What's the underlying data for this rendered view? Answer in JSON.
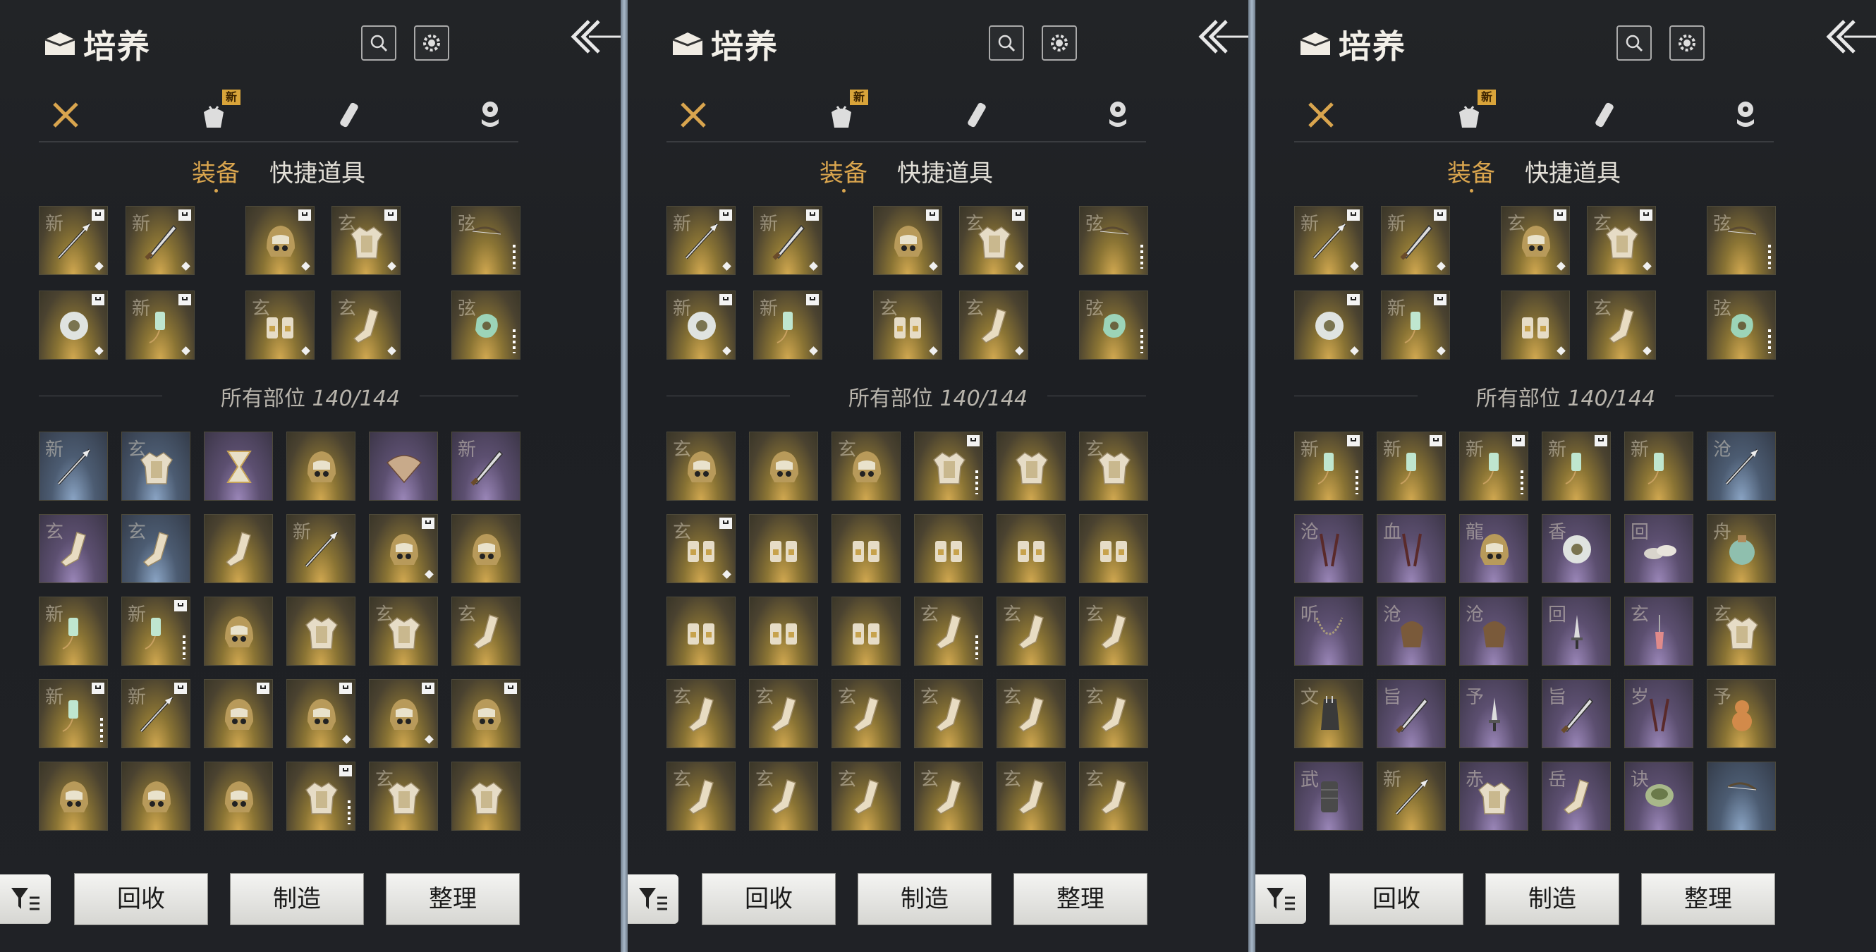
{
  "header": {
    "title": "培养",
    "search_icon": "search-icon",
    "settings_icon": "gear-icon",
    "back_icon": "back-arrows-icon"
  },
  "categories": [
    {
      "icon": "crossed-swords-icon",
      "active": true,
      "new": false
    },
    {
      "icon": "bundle-icon",
      "active": false,
      "new": true,
      "badge": "新"
    },
    {
      "icon": "scroll-icon",
      "active": false,
      "new": false
    },
    {
      "icon": "coin-stack-icon",
      "active": false,
      "new": false
    }
  ],
  "tabs": {
    "equipment": "装备",
    "quick_items": "快捷道具"
  },
  "section_label": "所有部位",
  "section_count": "140/144",
  "buttons": {
    "recycle": "回收",
    "craft": "制造",
    "sort": "整理",
    "filter_icon": "filter-icon"
  },
  "colors": {
    "gold": "#d9a54e",
    "panel_bg": "#1f2125",
    "divider": "#a8b8c8"
  },
  "panels": [
    {
      "equipped": [
        {
          "ch": "新",
          "type": "spear",
          "r": "gold",
          "flag": true,
          "mark": "dia"
        },
        {
          "ch": "新",
          "type": "blade",
          "r": "gold",
          "flag": true,
          "mark": "dia"
        },
        {
          "ch": "",
          "type": "helmet",
          "r": "gold",
          "flag": true,
          "mark": "dia"
        },
        {
          "ch": "玄",
          "type": "armor",
          "r": "gold",
          "flag": true,
          "mark": "dia"
        },
        {
          "ch": "弦",
          "type": "bow",
          "r": "gold",
          "flag": false,
          "mark": "pips"
        },
        {
          "ch": "",
          "type": "ring",
          "r": "gold",
          "flag": true,
          "mark": "dia"
        },
        {
          "ch": "新",
          "type": "pendant",
          "r": "gold",
          "flag": true,
          "mark": "dia"
        },
        {
          "ch": "玄",
          "type": "gloves",
          "r": "gold",
          "flag": false,
          "mark": "dia"
        },
        {
          "ch": "玄",
          "type": "boots",
          "r": "gold",
          "flag": false,
          "mark": "dia"
        },
        {
          "ch": "弦",
          "type": "jade",
          "r": "gold",
          "flag": false,
          "mark": "pips"
        }
      ],
      "inventory": [
        {
          "ch": "新",
          "type": "spear",
          "r": "blue",
          "flag": false,
          "mark": "dot"
        },
        {
          "ch": "玄",
          "type": "armor",
          "r": "blue",
          "flag": false,
          "mark": "gem"
        },
        {
          "ch": "",
          "type": "hourglass",
          "r": "purple",
          "flag": false,
          "mark": "dot"
        },
        {
          "ch": "",
          "type": "helmet",
          "r": "gold",
          "flag": false,
          "mark": "dot"
        },
        {
          "ch": "",
          "type": "fan",
          "r": "purple",
          "flag": false,
          "mark": "dot"
        },
        {
          "ch": "新",
          "type": "blade",
          "r": "purple",
          "flag": false,
          "mark": "dot"
        },
        {
          "ch": "玄",
          "type": "boots",
          "r": "purple",
          "flag": false,
          "mark": "dot"
        },
        {
          "ch": "玄",
          "type": "boots",
          "r": "blue",
          "flag": false,
          "mark": "dot"
        },
        {
          "ch": "",
          "type": "boots",
          "r": "gold",
          "flag": false,
          "mark": "dot"
        },
        {
          "ch": "新",
          "type": "spear",
          "r": "gold",
          "flag": false,
          "mark": "dot"
        },
        {
          "ch": "",
          "type": "helmet",
          "r": "gold",
          "flag": true,
          "mark": "dia"
        },
        {
          "ch": "",
          "type": "helmet",
          "r": "gold",
          "flag": false,
          "mark": "dot"
        },
        {
          "ch": "新",
          "type": "pendant",
          "r": "gold",
          "flag": false,
          "mark": "dot"
        },
        {
          "ch": "新",
          "type": "pendant",
          "r": "gold",
          "flag": true,
          "mark": "pips"
        },
        {
          "ch": "",
          "type": "helmet",
          "r": "gold",
          "flag": false,
          "mark": "dot"
        },
        {
          "ch": "",
          "type": "armor",
          "r": "gold",
          "flag": false,
          "mark": "dot"
        },
        {
          "ch": "玄",
          "type": "armor",
          "r": "gold",
          "flag": false,
          "mark": "dot"
        },
        {
          "ch": "玄",
          "type": "boots",
          "r": "gold",
          "flag": false,
          "mark": "dot"
        },
        {
          "ch": "新",
          "type": "pendant",
          "r": "gold",
          "flag": true,
          "mark": "pips"
        },
        {
          "ch": "新",
          "type": "spear",
          "r": "gold",
          "flag": true,
          "mark": "dot"
        },
        {
          "ch": "",
          "type": "helmet",
          "r": "gold",
          "flag": true,
          "mark": "dot"
        },
        {
          "ch": "",
          "type": "helmet",
          "r": "gold",
          "flag": true,
          "mark": "dia"
        },
        {
          "ch": "",
          "type": "helmet",
          "r": "gold",
          "flag": true,
          "mark": "dia"
        },
        {
          "ch": "",
          "type": "helmet",
          "r": "gold",
          "flag": true,
          "mark": "dot"
        },
        {
          "ch": "",
          "type": "helmet",
          "r": "gold",
          "flag": false,
          "mark": "dot"
        },
        {
          "ch": "",
          "type": "helmet",
          "r": "gold",
          "flag": false,
          "mark": "dot"
        },
        {
          "ch": "",
          "type": "helmet",
          "r": "gold",
          "flag": false,
          "mark": "dot"
        },
        {
          "ch": "",
          "type": "armor",
          "r": "gold",
          "flag": true,
          "mark": "pips"
        },
        {
          "ch": "玄",
          "type": "armor",
          "r": "gold",
          "flag": false,
          "mark": "dot"
        },
        {
          "ch": "",
          "type": "armor",
          "r": "gold",
          "flag": false,
          "mark": "dot"
        }
      ]
    },
    {
      "equipped": [
        {
          "ch": "新",
          "type": "spear",
          "r": "gold",
          "flag": true,
          "mark": "dia"
        },
        {
          "ch": "新",
          "type": "blade",
          "r": "gold",
          "flag": true,
          "mark": "dia"
        },
        {
          "ch": "",
          "type": "helmet",
          "r": "gold",
          "flag": true,
          "mark": "dia"
        },
        {
          "ch": "玄",
          "type": "armor",
          "r": "gold",
          "flag": true,
          "mark": "dia"
        },
        {
          "ch": "弦",
          "type": "bow",
          "r": "gold",
          "flag": false,
          "mark": "pips"
        },
        {
          "ch": "新",
          "type": "ring",
          "r": "gold",
          "flag": true,
          "mark": "dia"
        },
        {
          "ch": "新",
          "type": "pendant",
          "r": "gold",
          "flag": true,
          "mark": "dia"
        },
        {
          "ch": "玄",
          "type": "gloves",
          "r": "gold",
          "flag": false,
          "mark": "dia"
        },
        {
          "ch": "玄",
          "type": "boots",
          "r": "gold",
          "flag": false,
          "mark": "dia"
        },
        {
          "ch": "弦",
          "type": "jade",
          "r": "gold",
          "flag": false,
          "mark": "pips"
        }
      ],
      "inventory": [
        {
          "ch": "玄",
          "type": "helmet",
          "r": "gold",
          "flag": false,
          "mark": "dot"
        },
        {
          "ch": "",
          "type": "helmet",
          "r": "gold",
          "flag": false,
          "mark": "dot"
        },
        {
          "ch": "玄",
          "type": "helmet",
          "r": "gold",
          "flag": false,
          "mark": "dot"
        },
        {
          "ch": "",
          "type": "armor",
          "r": "gold",
          "flag": true,
          "mark": "pips"
        },
        {
          "ch": "",
          "type": "armor",
          "r": "gold",
          "flag": false,
          "mark": "dot"
        },
        {
          "ch": "玄",
          "type": "armor",
          "r": "gold",
          "flag": false,
          "mark": "dot"
        },
        {
          "ch": "玄",
          "type": "gloves",
          "r": "gold",
          "flag": true,
          "mark": "dia"
        },
        {
          "ch": "",
          "type": "gloves",
          "r": "gold",
          "flag": false,
          "mark": "dot"
        },
        {
          "ch": "",
          "type": "gloves",
          "r": "gold",
          "flag": false,
          "mark": "dot"
        },
        {
          "ch": "",
          "type": "gloves",
          "r": "gold",
          "flag": false,
          "mark": "dot"
        },
        {
          "ch": "",
          "type": "gloves",
          "r": "gold",
          "flag": false,
          "mark": "dot"
        },
        {
          "ch": "",
          "type": "gloves",
          "r": "gold",
          "flag": false,
          "mark": "dot"
        },
        {
          "ch": "",
          "type": "gloves",
          "r": "gold",
          "flag": false,
          "mark": "dot"
        },
        {
          "ch": "",
          "type": "gloves",
          "r": "gold",
          "flag": false,
          "mark": "dot"
        },
        {
          "ch": "",
          "type": "gloves",
          "r": "gold",
          "flag": false,
          "mark": "dot"
        },
        {
          "ch": "玄",
          "type": "boots",
          "r": "gold",
          "flag": false,
          "mark": "pips"
        },
        {
          "ch": "玄",
          "type": "boots",
          "r": "gold",
          "flag": false,
          "mark": "dot"
        },
        {
          "ch": "玄",
          "type": "boots",
          "r": "gold",
          "flag": false,
          "mark": "dot"
        },
        {
          "ch": "玄",
          "type": "boots",
          "r": "gold",
          "flag": false,
          "mark": "dot"
        },
        {
          "ch": "玄",
          "type": "boots",
          "r": "gold",
          "flag": false,
          "mark": "dot"
        },
        {
          "ch": "玄",
          "type": "boots",
          "r": "gold",
          "flag": false,
          "mark": "dot"
        },
        {
          "ch": "玄",
          "type": "boots",
          "r": "gold",
          "flag": false,
          "mark": "dot"
        },
        {
          "ch": "玄",
          "type": "boots",
          "r": "gold",
          "flag": false,
          "mark": "dot"
        },
        {
          "ch": "玄",
          "type": "boots",
          "r": "gold",
          "flag": false,
          "mark": "dot"
        },
        {
          "ch": "玄",
          "type": "boots",
          "r": "gold",
          "flag": false,
          "mark": "dot"
        },
        {
          "ch": "玄",
          "type": "boots",
          "r": "gold",
          "flag": false,
          "mark": "dot"
        },
        {
          "ch": "玄",
          "type": "boots",
          "r": "gold",
          "flag": false,
          "mark": "dot"
        },
        {
          "ch": "玄",
          "type": "boots",
          "r": "gold",
          "flag": false,
          "mark": "dot"
        },
        {
          "ch": "玄",
          "type": "boots",
          "r": "gold",
          "flag": false,
          "mark": "dot"
        },
        {
          "ch": "玄",
          "type": "boots",
          "r": "gold",
          "flag": false,
          "mark": "dot"
        }
      ]
    },
    {
      "equipped": [
        {
          "ch": "新",
          "type": "spear",
          "r": "gold",
          "flag": true,
          "mark": "dia"
        },
        {
          "ch": "新",
          "type": "blade",
          "r": "gold",
          "flag": true,
          "mark": "dia"
        },
        {
          "ch": "玄",
          "type": "helmet",
          "r": "gold",
          "flag": true,
          "mark": "dia"
        },
        {
          "ch": "玄",
          "type": "armor",
          "r": "gold",
          "flag": true,
          "mark": "dia"
        },
        {
          "ch": "弦",
          "type": "bow",
          "r": "gold",
          "flag": false,
          "mark": "pips"
        },
        {
          "ch": "",
          "type": "ring",
          "r": "gold",
          "flag": true,
          "mark": "dia"
        },
        {
          "ch": "新",
          "type": "pendant",
          "r": "gold",
          "flag": true,
          "mark": "dia"
        },
        {
          "ch": "",
          "type": "gloves",
          "r": "gold",
          "flag": false,
          "mark": "dia"
        },
        {
          "ch": "玄",
          "type": "boots",
          "r": "gold",
          "flag": false,
          "mark": "dia"
        },
        {
          "ch": "弦",
          "type": "jade",
          "r": "gold",
          "flag": false,
          "mark": "pips"
        }
      ],
      "inventory": [
        {
          "ch": "新",
          "type": "pendant",
          "r": "gold",
          "flag": true,
          "mark": "pips"
        },
        {
          "ch": "新",
          "type": "pendant",
          "r": "gold",
          "flag": true,
          "mark": "dot"
        },
        {
          "ch": "新",
          "type": "pendant",
          "r": "gold",
          "flag": true,
          "mark": "pips"
        },
        {
          "ch": "新",
          "type": "pendant",
          "r": "gold",
          "flag": true,
          "mark": "dot"
        },
        {
          "ch": "新",
          "type": "pendant",
          "r": "gold",
          "flag": false,
          "mark": "dot"
        },
        {
          "ch": "沧",
          "type": "spear",
          "r": "blue",
          "flag": false,
          "mark": "dot"
        },
        {
          "ch": "沧",
          "type": "sticks",
          "r": "purple",
          "flag": false,
          "mark": "dot"
        },
        {
          "ch": "血",
          "type": "sticks",
          "r": "purple",
          "flag": false,
          "mark": "dot"
        },
        {
          "ch": "龍",
          "type": "helmet",
          "r": "purple",
          "flag": false,
          "mark": "dot"
        },
        {
          "ch": "香",
          "type": "ring",
          "r": "purple",
          "flag": false,
          "mark": "dot"
        },
        {
          "ch": "回",
          "type": "shoes",
          "r": "purple",
          "flag": false,
          "mark": "dot"
        },
        {
          "ch": "舟",
          "type": "pouch",
          "r": "gold",
          "flag": false,
          "mark": "dot"
        },
        {
          "ch": "听",
          "type": "necklace",
          "r": "purple",
          "flag": false,
          "mark": "dot"
        },
        {
          "ch": "沧",
          "type": "bag",
          "r": "purple",
          "flag": false,
          "mark": "dot"
        },
        {
          "ch": "沧",
          "type": "bag",
          "r": "purple",
          "flag": false,
          "mark": "dot"
        },
        {
          "ch": "回",
          "type": "dagger",
          "r": "purple",
          "flag": false,
          "mark": "dot"
        },
        {
          "ch": "玄",
          "type": "tassel",
          "r": "purple",
          "flag": false,
          "mark": "dot"
        },
        {
          "ch": "玄",
          "type": "armor",
          "r": "gold",
          "flag": false,
          "mark": "dot"
        },
        {
          "ch": "文",
          "type": "quiver",
          "r": "gold",
          "flag": false,
          "mark": "dot"
        },
        {
          "ch": "旨",
          "type": "blade",
          "r": "purple",
          "flag": false,
          "mark": "dot"
        },
        {
          "ch": "予",
          "type": "dagger",
          "r": "purple",
          "flag": false,
          "mark": "dot"
        },
        {
          "ch": "旨",
          "type": "blade",
          "r": "purple",
          "flag": false,
          "mark": "dot"
        },
        {
          "ch": "岁",
          "type": "sticks",
          "r": "purple",
          "flag": false,
          "mark": "dot"
        },
        {
          "ch": "予",
          "type": "gourd",
          "r": "gold",
          "flag": false,
          "mark": "dot"
        },
        {
          "ch": "武",
          "type": "bracer",
          "r": "purple",
          "flag": false,
          "mark": "dot"
        },
        {
          "ch": "新",
          "type": "spear",
          "r": "gold",
          "flag": false,
          "mark": "dot"
        },
        {
          "ch": "赤",
          "type": "armor",
          "r": "purple",
          "flag": false,
          "mark": "dot"
        },
        {
          "ch": "岳",
          "type": "boots",
          "r": "purple",
          "flag": false,
          "mark": "dot"
        },
        {
          "ch": "诀",
          "type": "bowl",
          "r": "purple",
          "flag": false,
          "mark": "dot"
        },
        {
          "ch": "",
          "type": "bow",
          "r": "blue",
          "flag": false,
          "mark": "dot"
        }
      ]
    }
  ]
}
